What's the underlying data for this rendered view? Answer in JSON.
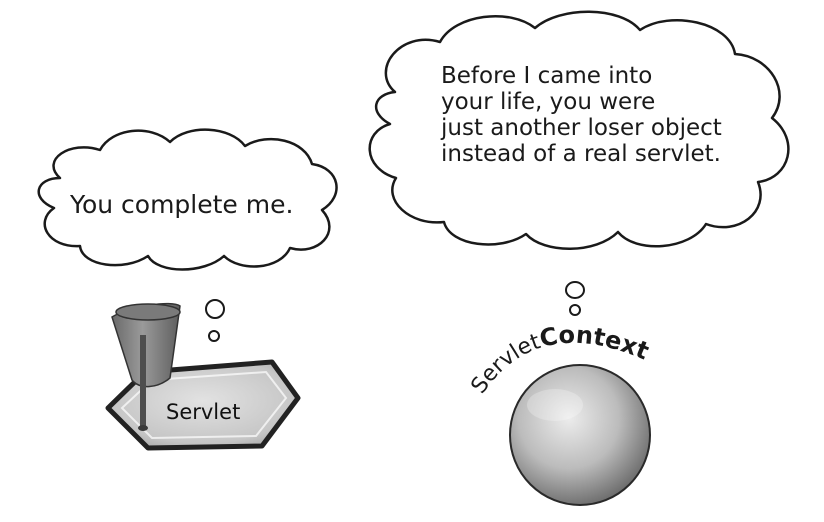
{
  "left_bubble": {
    "text": "You complete me."
  },
  "right_bubble": {
    "lines": [
      "Before I came into",
      "your life, you were",
      "just another loser object",
      "instead of a real servlet."
    ]
  },
  "servlet": {
    "label": "Servlet",
    "hat_icon": "fez-hat-icon"
  },
  "context": {
    "label_prefix": "Servlet",
    "label_suffix": "Context"
  },
  "colors": {
    "ink": "#1a1a1a",
    "sphere_light": "#e4e4e4",
    "sphere_dark": "#6e6e6e",
    "hexagon_fill": "#c9c9c9",
    "hat_fill": "#8a8a8a"
  }
}
